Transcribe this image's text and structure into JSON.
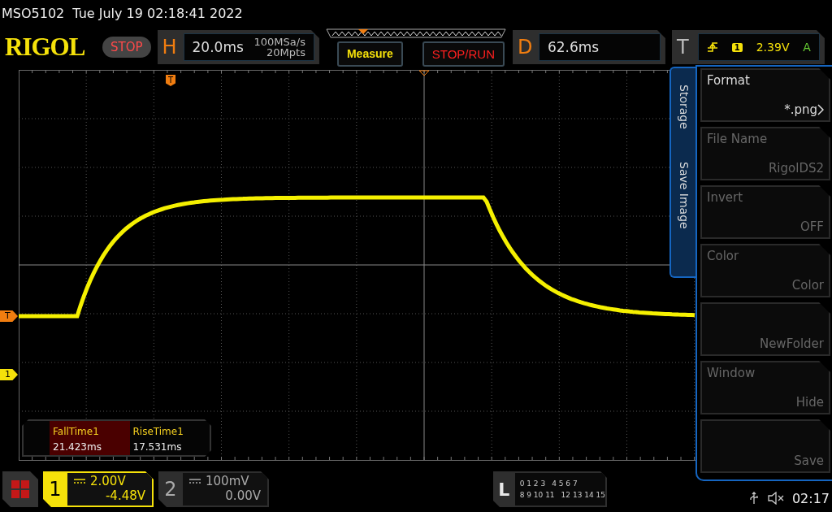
{
  "header": {
    "model": "MSO5102",
    "datetime": "Tue July 19 02:18:41 2022"
  },
  "toolbar": {
    "logo": "RIGOL",
    "run_state": "STOP",
    "horizontal": {
      "key": "H",
      "timebase": "20.0ms",
      "sample_rate": "100MSa/s",
      "memory_depth": "20Mpts"
    },
    "buttons": [
      {
        "label": "Measure",
        "kind": "measure"
      },
      {
        "label": "STOP/RUN",
        "kind": "run"
      }
    ],
    "delay": {
      "key": "D",
      "value": "62.6ms"
    },
    "trigger": {
      "key": "T",
      "source": "1",
      "voltage": "2.39V",
      "mode": "A"
    }
  },
  "display": {
    "trigger_position_marker": "T",
    "trigger_level_marker": "T",
    "channel_marker": "1"
  },
  "measurements": [
    {
      "name": "FallTime1",
      "value": "21.423ms",
      "selected": true
    },
    {
      "name": "RiseTime1",
      "value": "17.531ms",
      "selected": false
    }
  ],
  "menu": {
    "tabs": [
      "Storage",
      "Save Image"
    ],
    "items": [
      {
        "label": "Format",
        "value": "*.png",
        "enabled": true,
        "submenu": true
      },
      {
        "label": "File Name",
        "value": "RigolDS2",
        "enabled": false,
        "submenu": false
      },
      {
        "label": "Invert",
        "value": "OFF",
        "enabled": false,
        "submenu": false
      },
      {
        "label": "Color",
        "value": "Color",
        "enabled": false,
        "submenu": false
      },
      {
        "value": "NewFolder",
        "enabled": false,
        "submenu": false
      },
      {
        "label": "Window",
        "value": "Hide",
        "enabled": false,
        "submenu": false
      },
      {
        "value": "Save",
        "enabled": false,
        "submenu": false
      }
    ]
  },
  "channels": [
    {
      "number": "1",
      "scale": "2.00V",
      "offset": "-4.48V",
      "active": true
    },
    {
      "number": "2",
      "scale": "100mV",
      "offset": "0.00V",
      "active": false
    }
  ],
  "logic": {
    "key": "L",
    "rows": [
      [
        "0 1 2 3",
        "4 5 6 7"
      ],
      [
        "8 9 10 11",
        "12 13 14 15"
      ]
    ]
  },
  "status": {
    "time": "02:17",
    "muted": true
  }
}
